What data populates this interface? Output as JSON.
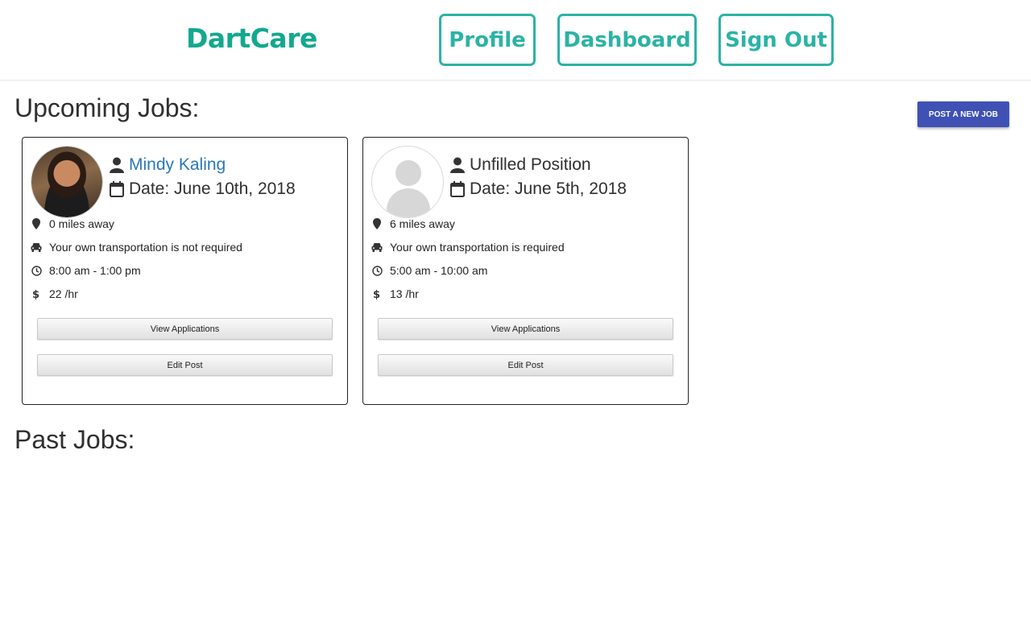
{
  "header": {
    "logo": "DartCare",
    "nav": {
      "profile": "Profile",
      "dashboard": "Dashboard",
      "sign_out": "Sign Out"
    }
  },
  "colors": {
    "brand": "#13a88f",
    "nav_accent": "#2bb3a5",
    "primary_button": "#3f51b5",
    "link": "#2a78b6"
  },
  "upcoming": {
    "title": "Upcoming Jobs:",
    "post_button": "POST A NEW JOB",
    "jobs": [
      {
        "name": "Mindy Kaling",
        "date": "Date: June 10th, 2018",
        "distance": "0 miles away",
        "transport": "Your own transportation is not required",
        "time": "8:00 am - 1:00 pm",
        "rate": "22 /hr",
        "view_label": "View Applications",
        "edit_label": "Edit Post"
      },
      {
        "name": "Unfilled Position",
        "date": "Date: June 5th, 2018",
        "distance": "6 miles away",
        "transport": "Your own transportation is required",
        "time": "5:00 am - 10:00 am",
        "rate": "13 /hr",
        "view_label": "View Applications",
        "edit_label": "Edit Post"
      }
    ]
  },
  "past": {
    "title": "Past Jobs:"
  },
  "icons": {
    "user": "user-icon",
    "calendar": "calendar-icon",
    "location": "map-pin-icon",
    "car": "car-icon",
    "clock": "clock-icon",
    "dollar": "dollar-icon"
  }
}
